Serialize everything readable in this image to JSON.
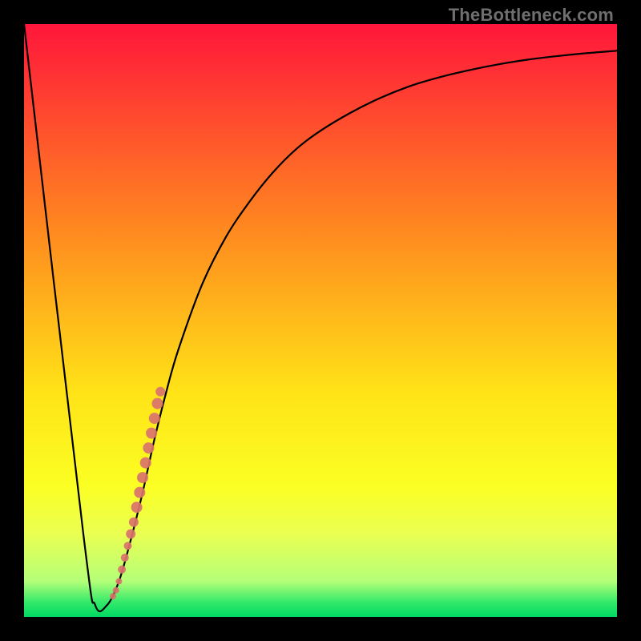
{
  "watermark": "TheBottleneck.com",
  "chart_data": {
    "type": "line",
    "title": "",
    "xlabel": "",
    "ylabel": "",
    "xlim": [
      0,
      100
    ],
    "ylim": [
      0,
      100
    ],
    "grid": false,
    "legend": false,
    "gradient_stops": [
      {
        "offset": 0.0,
        "color": "#ff163b"
      },
      {
        "offset": 0.35,
        "color": "#ff8a1f"
      },
      {
        "offset": 0.62,
        "color": "#ffe317"
      },
      {
        "offset": 0.78,
        "color": "#fbff23"
      },
      {
        "offset": 0.86,
        "color": "#eaff52"
      },
      {
        "offset": 0.94,
        "color": "#b4ff78"
      },
      {
        "offset": 0.975,
        "color": "#34e96a"
      },
      {
        "offset": 1.0,
        "color": "#00d863"
      }
    ],
    "series": [
      {
        "name": "bottleneck-curve",
        "x": [
          0,
          10,
          12,
          14,
          16,
          18,
          20,
          22,
          24,
          26,
          30,
          34,
          38,
          42,
          46,
          50,
          55,
          60,
          65,
          70,
          75,
          80,
          85,
          90,
          95,
          100
        ],
        "y": [
          100,
          14,
          2,
          2,
          6,
          13,
          21,
          30,
          38,
          45,
          56,
          64,
          70,
          75,
          79,
          82,
          85,
          87.5,
          89.5,
          91,
          92.2,
          93.2,
          94,
          94.6,
          95.1,
          95.5
        ]
      }
    ],
    "scatter": {
      "name": "sample-points",
      "color": "#d9736b",
      "x": [
        17.0,
        17.5,
        18.0,
        18.5,
        19.0,
        19.5,
        20.0,
        20.5,
        21.0,
        21.5,
        22.0,
        22.5,
        23.0,
        16.5,
        16.0,
        15.5,
        15.0
      ],
      "y": [
        10.0,
        12.0,
        14.0,
        16.0,
        18.5,
        21.0,
        23.5,
        26.0,
        28.5,
        31.0,
        33.5,
        36.0,
        38.0,
        8.0,
        6.0,
        4.5,
        3.5
      ],
      "r": [
        5,
        5,
        6,
        6,
        7,
        7,
        7,
        7,
        7,
        7,
        7,
        7,
        6,
        5,
        4,
        4,
        4
      ]
    }
  }
}
